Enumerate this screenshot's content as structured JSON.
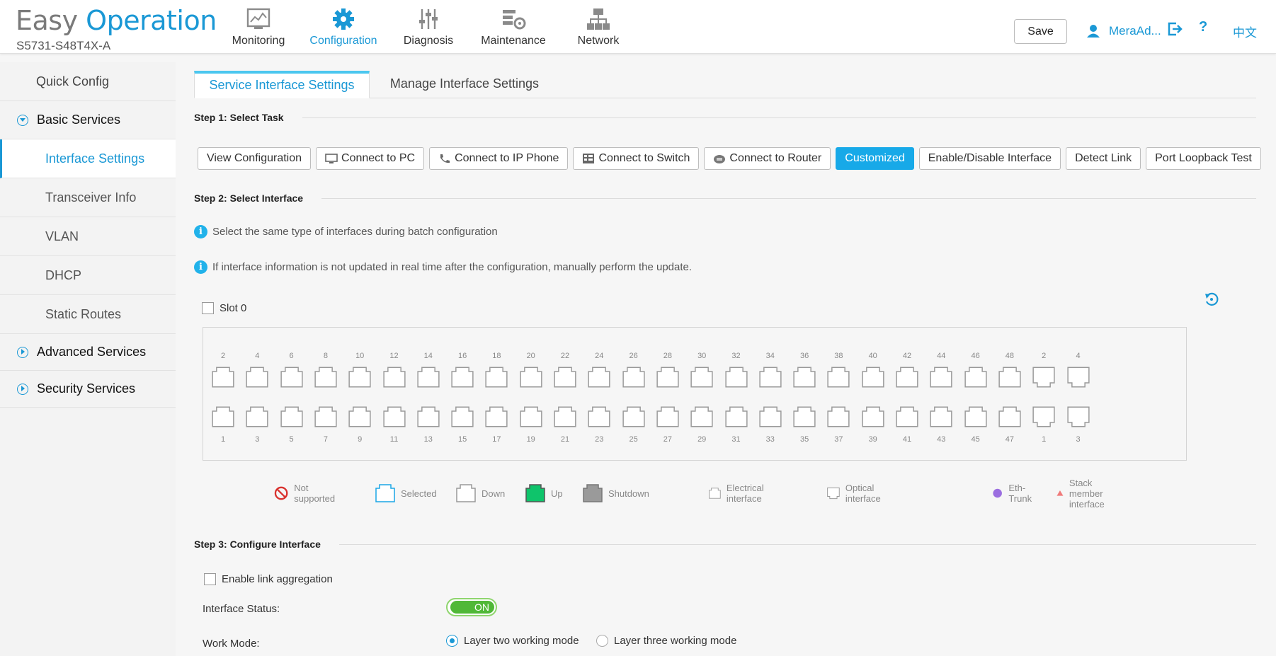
{
  "brand": {
    "part1": "Easy ",
    "part2": "Operation",
    "model": "S5731-S48T4X-A"
  },
  "nav": [
    {
      "label": "Monitoring",
      "icon": "monitor-chart-icon"
    },
    {
      "label": "Configuration",
      "icon": "gear-icon"
    },
    {
      "label": "Diagnosis",
      "icon": "sliders-icon"
    },
    {
      "label": "Maintenance",
      "icon": "tools-icon"
    },
    {
      "label": "Network",
      "icon": "topology-icon"
    }
  ],
  "header": {
    "save_label": "Save",
    "user": "MeraAd...",
    "help": "?",
    "lang": "中文"
  },
  "colors": {
    "accent": "#1a98d5",
    "active_button": "#17a9e8",
    "up": "#0fc46b",
    "shutdown": "#9a9a9a",
    "eth_trunk": "#9b6ee0",
    "stack_member": "#f07a7a",
    "toggle_on": "#50b837"
  },
  "sidebar": {
    "quick_config": "Quick Config",
    "basic_services": "Basic Services",
    "items": [
      "Interface Settings",
      "Transceiver Info",
      "VLAN",
      "DHCP",
      "Static Routes"
    ],
    "advanced_services": "Advanced Services",
    "security_services": "Security Services"
  },
  "tabs": [
    "Service Interface Settings",
    "Manage Interface Settings"
  ],
  "step1": {
    "title": "Step 1:  Select Task",
    "tasks": [
      {
        "label": "View Configuration",
        "icon": ""
      },
      {
        "label": "Connect to PC",
        "icon": "pc-icon"
      },
      {
        "label": "Connect to IP Phone",
        "icon": "phone-icon"
      },
      {
        "label": "Connect to Switch",
        "icon": "switch-icon"
      },
      {
        "label": "Connect to Router",
        "icon": "router-icon"
      },
      {
        "label": "Customized",
        "icon": "",
        "active": true
      },
      {
        "label": "Enable/Disable Interface",
        "icon": ""
      },
      {
        "label": "Detect Link",
        "icon": ""
      },
      {
        "label": "Port Loopback Test",
        "icon": ""
      }
    ]
  },
  "step2": {
    "title": "Step 2:  Select Interface",
    "info1": "Select the same type of interfaces during batch configuration",
    "info2": "If interface information is not updated in real time after the configuration, manually perform the update.",
    "slot_label": "Slot 0",
    "top_ports": [
      "2",
      "4",
      "6",
      "8",
      "10",
      "12",
      "14",
      "16",
      "18",
      "20",
      "22",
      "24",
      "26",
      "28",
      "30",
      "32",
      "34",
      "36",
      "38",
      "40",
      "42",
      "44",
      "46",
      "48",
      "2",
      "4"
    ],
    "bottom_ports": [
      "1",
      "3",
      "5",
      "7",
      "9",
      "11",
      "13",
      "15",
      "17",
      "19",
      "21",
      "23",
      "25",
      "27",
      "29",
      "31",
      "33",
      "35",
      "37",
      "39",
      "41",
      "43",
      "45",
      "47",
      "1",
      "3"
    ],
    "optical_from_index": 24
  },
  "legend": {
    "not_supported": "Not supported",
    "selected": "Selected",
    "down": "Down",
    "up": "Up",
    "shutdown": "Shutdown",
    "electrical": "Electrical interface",
    "optical": "Optical interface",
    "eth_trunk": "Eth-Trunk",
    "stack_member": "Stack member interface"
  },
  "step3": {
    "title": "Step 3:  Configure Interface",
    "link_agg": "Enable link aggregation",
    "status_label": "Interface Status:",
    "status_value": "ON",
    "work_mode_label": "Work Mode:",
    "mode_l2": "Layer two working mode",
    "mode_l3": "Layer three working mode"
  }
}
